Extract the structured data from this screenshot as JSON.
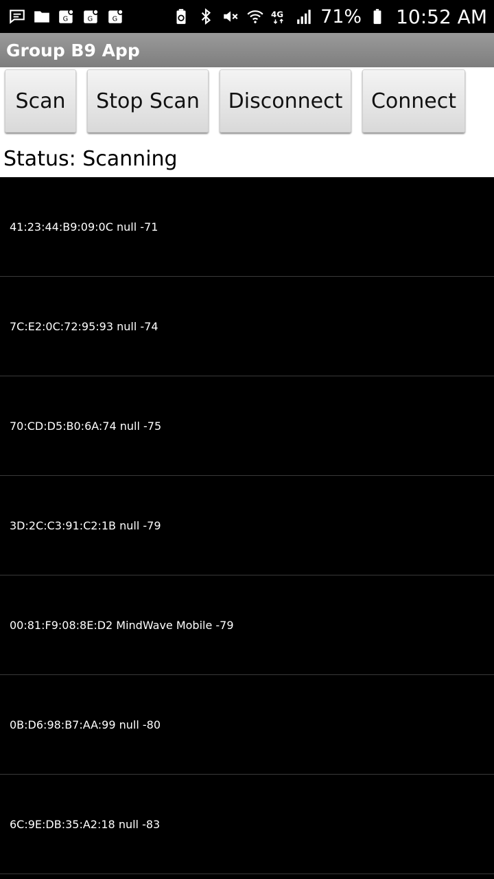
{
  "status_bar": {
    "left_icons": [
      "message-icon",
      "folder-icon",
      "location-game-icon",
      "location-game-icon",
      "location-game-icon"
    ],
    "right_icons": [
      "battery-saver-icon",
      "bluetooth-icon",
      "mute-icon",
      "wifi-icon",
      "lte-icon",
      "signal-icon"
    ],
    "battery_percent": "71%",
    "time": "10:52 AM"
  },
  "app": {
    "title": "Group B9 App"
  },
  "toolbar": {
    "scan_label": "Scan",
    "stop_scan_label": "Stop Scan",
    "disconnect_label": "Disconnect",
    "connect_label": "Connect"
  },
  "status": {
    "text": "Status: Scanning"
  },
  "devices": [
    "41:23:44:B9:09:0C null -71",
    "7C:E2:0C:72:95:93 null -74",
    "70:CD:D5:B0:6A:74 null -75",
    "3D:2C:C3:91:C2:1B null -79",
    "00:81:F9:08:8E:D2 MindWave Mobile -79",
    "0B:D6:98:B7:AA:99 null -80",
    "6C:9E:DB:35:A2:18 null -83"
  ]
}
